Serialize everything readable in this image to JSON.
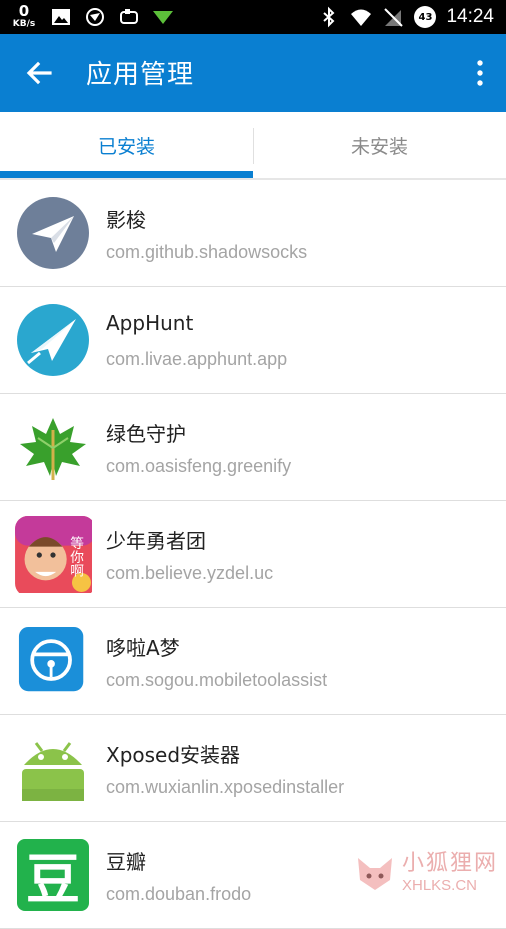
{
  "status_bar": {
    "speed_value": "0",
    "speed_unit": "KB/s",
    "battery_level": "43",
    "time": "14:24",
    "icons_left": [
      "image-icon",
      "browser-icon",
      "cloud-icon",
      "wifi-share-icon"
    ],
    "icons_right": [
      "bluetooth-icon",
      "wifi-icon",
      "no-sim-icon",
      "battery-icon"
    ]
  },
  "app_bar": {
    "title": "应用管理",
    "color": "#0a7fd1"
  },
  "tabs": [
    {
      "label": "已安装",
      "selected": true
    },
    {
      "label": "未安装",
      "selected": false
    }
  ],
  "apps": [
    {
      "name": "影梭",
      "package": "com.github.shadowsocks",
      "icon": "paper-plane-gray-icon"
    },
    {
      "name": "AppHunt",
      "package": "com.livae.apphunt.app",
      "icon": "paper-plane-blue-icon"
    },
    {
      "name": "绿色守护",
      "package": "com.oasisfeng.greenify",
      "icon": "green-leaf-icon"
    },
    {
      "name": "少年勇者团",
      "package": "com.believe.yzdel.uc",
      "icon": "game-character-icon",
      "icon_text": "等你啊"
    },
    {
      "name": "哆啦A梦",
      "package": "com.sogou.mobiletoolassist",
      "icon": "bell-icon"
    },
    {
      "name": "Xposed安装器",
      "package": "com.wuxianlin.xposedinstaller",
      "icon": "android-icon"
    },
    {
      "name": "豆瓣",
      "package": "com.douban.frodo",
      "icon": "douban-icon",
      "icon_text": "豆"
    }
  ],
  "watermark": {
    "text_cn": "小狐狸网",
    "text_en": "XHLKS.CN"
  }
}
